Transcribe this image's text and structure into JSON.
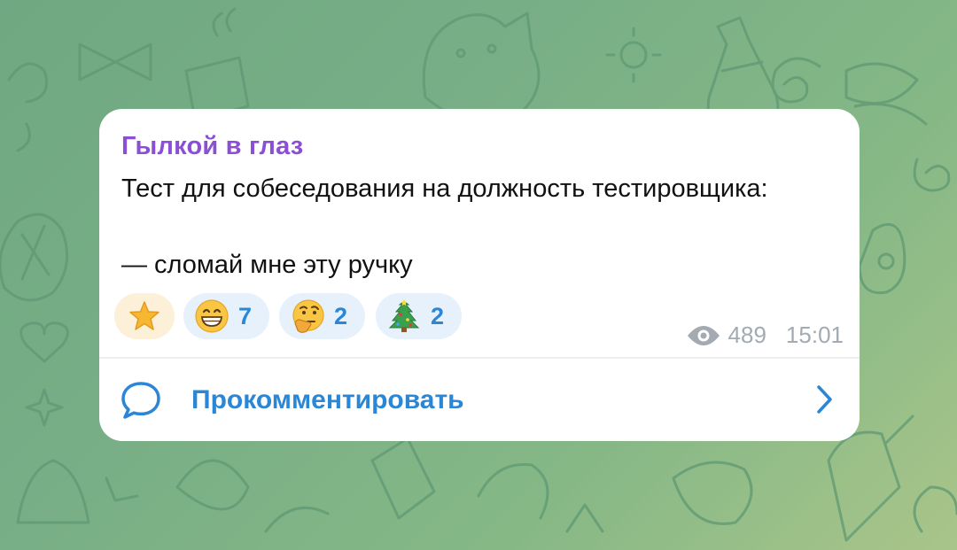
{
  "post": {
    "sender": "Гылкой в глаз",
    "text_line1": "Тест для собеседования на должность тестировщика:",
    "text_line2": " — сломай мне эту ручку"
  },
  "reactions": [
    {
      "icon": "star-emoji",
      "count": ""
    },
    {
      "icon": "grinning-face-emoji",
      "count": "7"
    },
    {
      "icon": "thinking-face-emoji",
      "count": "2"
    },
    {
      "icon": "christmas-tree-emoji",
      "count": "2"
    }
  ],
  "meta": {
    "views": "489",
    "time": "15:01"
  },
  "comment_bar": {
    "label": "Прокомментировать"
  },
  "colors": {
    "sender": "#8a4fd6",
    "accent": "#2b87d6",
    "meta": "#a3aab1",
    "background": "#78ae86"
  }
}
